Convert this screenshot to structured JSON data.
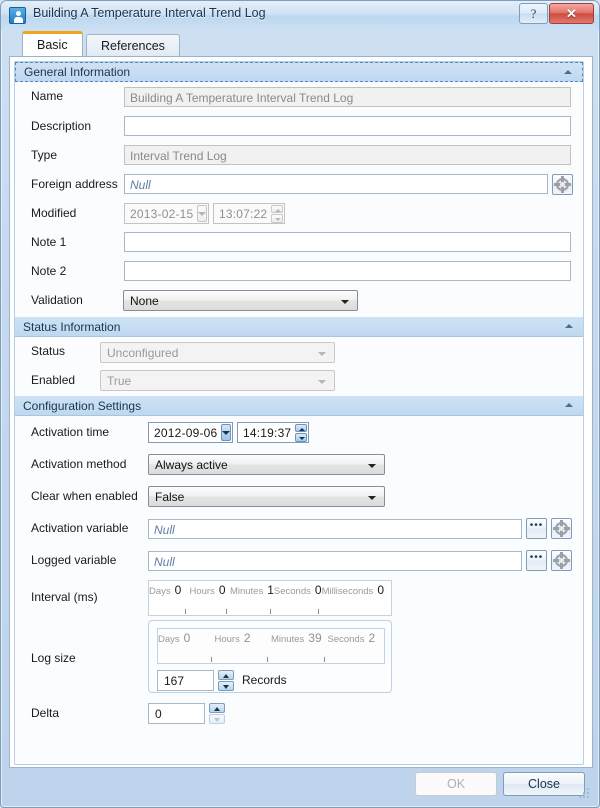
{
  "window": {
    "title": "Building A Temperature Interval Trend Log",
    "icon": "trend-log-icon",
    "help_label": "?",
    "close_label": "✕"
  },
  "tabs": [
    {
      "label": "Basic",
      "selected": true
    },
    {
      "label": "References",
      "selected": false
    }
  ],
  "sections": {
    "general": {
      "title": "General Information",
      "fields": {
        "name": {
          "label": "Name",
          "value": "Building A Temperature Interval Trend Log",
          "readonly": true
        },
        "description": {
          "label": "Description",
          "value": "",
          "readonly": false
        },
        "type": {
          "label": "Type",
          "value": "Interval Trend Log",
          "readonly": true
        },
        "foreign_address": {
          "label": "Foreign address",
          "value": "Null",
          "readonly": false
        },
        "modified": {
          "label": "Modified",
          "date": "2013-02-15",
          "time": "13:07:22",
          "readonly": true
        },
        "note1": {
          "label": "Note 1",
          "value": "",
          "readonly": false
        },
        "note2": {
          "label": "Note 2",
          "value": "",
          "readonly": false
        },
        "validation": {
          "label": "Validation",
          "value": "None"
        }
      }
    },
    "status": {
      "title": "Status Information",
      "fields": {
        "status": {
          "label": "Status",
          "value": "Unconfigured",
          "disabled": true
        },
        "enabled": {
          "label": "Enabled",
          "value": "True",
          "disabled": true
        }
      }
    },
    "configuration": {
      "title": "Configuration Settings",
      "fields": {
        "activation_time": {
          "label": "Activation time",
          "date": "2012-09-06",
          "time": "14:19:37"
        },
        "activation_method": {
          "label": "Activation method",
          "value": "Always active"
        },
        "clear_when_enabled": {
          "label": "Clear when enabled",
          "value": "False"
        },
        "activation_variable": {
          "label": "Activation variable",
          "value": "Null"
        },
        "logged_variable": {
          "label": "Logged variable",
          "value": "Null"
        },
        "interval": {
          "label": "Interval (ms)",
          "headers": [
            "Days",
            "Hours",
            "Minutes",
            "Seconds",
            "Milliseconds"
          ],
          "values": [
            "0",
            "0",
            "1",
            "0",
            "0"
          ]
        },
        "log_size": {
          "label": "Log size",
          "headers": [
            "Days",
            "Hours",
            "Minutes",
            "Seconds"
          ],
          "values": [
            "0",
            "2",
            "39",
            "2"
          ],
          "records_value": "167",
          "records_label": "Records"
        },
        "delta": {
          "label": "Delta",
          "value": "0"
        }
      }
    }
  },
  "footer": {
    "ok_label": "OK",
    "ok_disabled": true,
    "close_label": "Close"
  },
  "browse_button_label": "•••",
  "colors": {
    "accent_tab": "#f0a41c",
    "section_header": "#cfe2f5",
    "close_button": "#cf4a40",
    "null_text": "#5b7fa6"
  }
}
